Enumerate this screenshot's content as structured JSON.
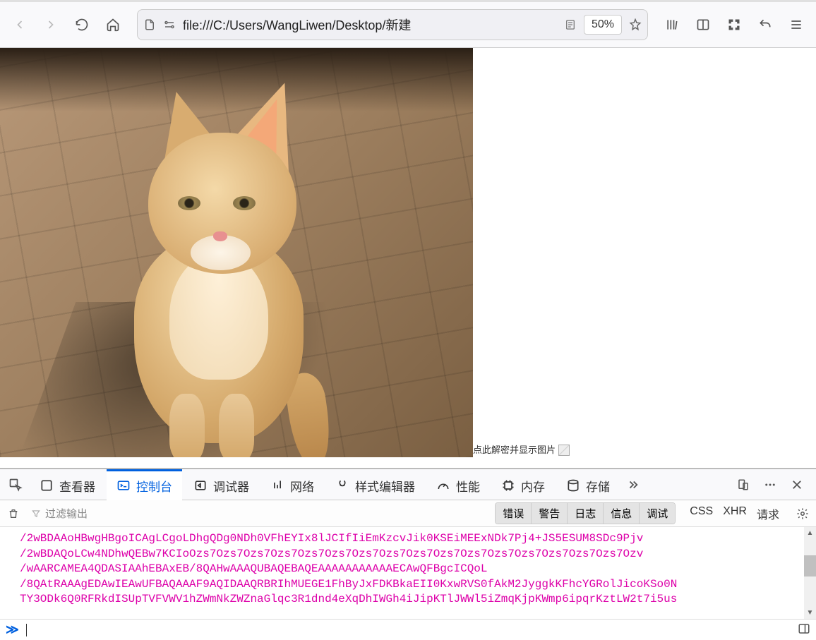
{
  "toolbar": {
    "url": "file:///C:/Users/WangLiwen/Desktop/新建",
    "zoom": "50%"
  },
  "page": {
    "caption": "点此解密并显示图片"
  },
  "devtools": {
    "tabs": {
      "inspector": "查看器",
      "console": "控制台",
      "debugger": "调试器",
      "network": "网络",
      "style": "样式编辑器",
      "performance": "性能",
      "memory": "内存",
      "storage": "存储"
    },
    "filter": {
      "placeholder": "过滤输出",
      "levels": {
        "error": "错误",
        "warn": "警告",
        "log": "日志",
        "info": "信息",
        "debug": "调试"
      },
      "net": {
        "css": "CSS",
        "xhr": "XHR",
        "req": "请求"
      }
    },
    "lines": [
      "/2wBDAAoHBwgHBgoICAgLCgoLDhgQDg0NDh0VFhEYIx8lJCIfIiEmKzcvJik0KSEiMEExNDk7Pj4+JS5ESUM8SDc9Pjv",
      "/2wBDAQoLCw4NDhwQEBw7KCIoOzs7Ozs7Ozs7Ozs7Ozs7Ozs7Ozs7Ozs7Ozs7Ozs7Ozs7Ozs7Ozs7Ozs7Ozs7Ozs7Ozv",
      "/wAARCAMEA4QDASIAAhEBAxEB/8QAHwAAAQUBAQEBAQEAAAAAAAAAAAECAwQFBgcICQoL",
      "/8QAtRAAAgEDAwIEAwUFBAQAAAF9AQIDAAQRBRIhMUEGE1FhByJxFDKBkaEII0KxwRVS0fAkM2JyggkKFhcYGRolJicoKSo0N",
      "TY3ODk6Q0RFRkdISUpTVFVWV1hZWmNkZWZnaGlqc3R1dnd4eXqDhIWGh4iJipKTlJWWl5iZmqKjpKWmp6ipqrKztLW2t7i5us"
    ]
  }
}
